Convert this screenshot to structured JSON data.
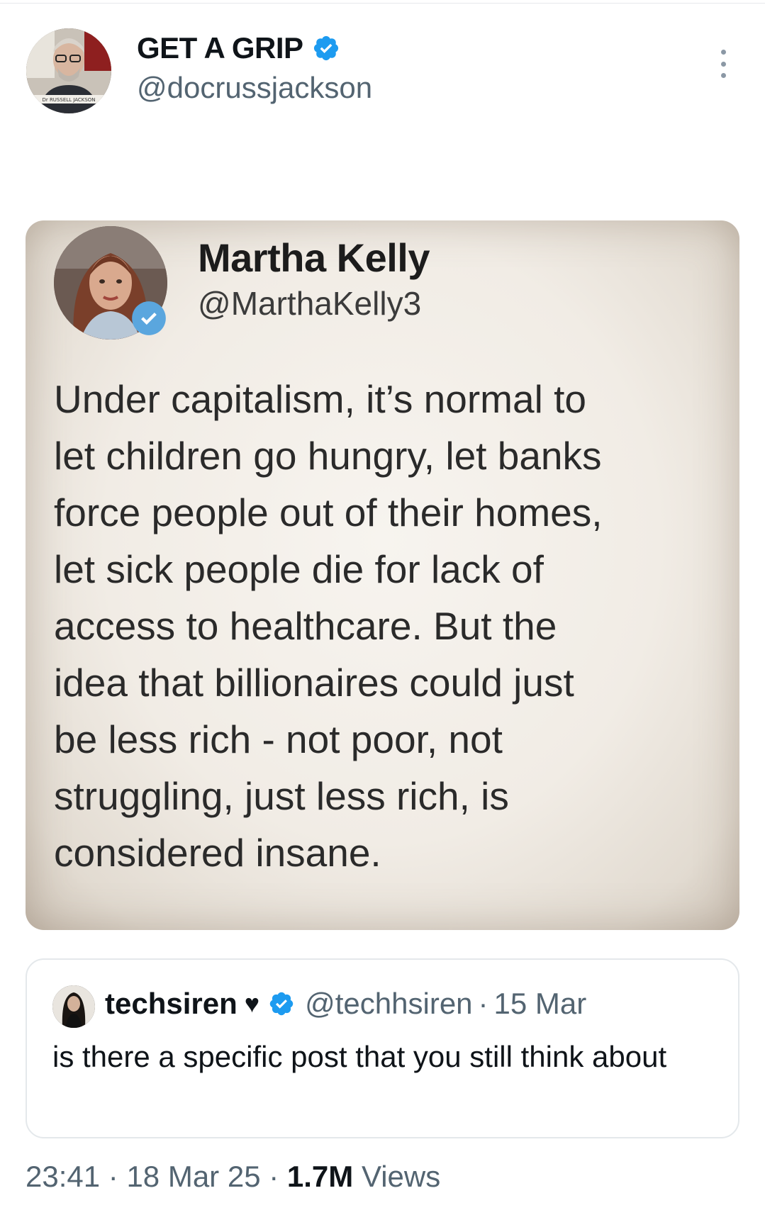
{
  "tweet": {
    "display_name": "GET A GRIP",
    "handle": "@docrussjackson",
    "avatar_caption": "Dr RUSSELL JACKSON",
    "verified_color": "#1d9bf0"
  },
  "media": {
    "name": "Martha Kelly",
    "handle": "@MarthaKelly3",
    "text": "Under capitalism, it’s normal to\nlet children go hungry, let banks\nforce people out of their homes,\nlet sick people die for lack of\naccess to healthcare. But the\nidea that billionaires could just\nbe less rich - not poor, not\nstruggling, just less rich, is\nconsidered insane."
  },
  "quote": {
    "name": "techsiren",
    "heart": "♥",
    "handle": "@techhsiren",
    "separator": "·",
    "date": "15 Mar",
    "text": "is there a specific post that you still think about"
  },
  "meta": {
    "time": "23:41",
    "sep1": "·",
    "date": "18 Mar 25",
    "sep2": "·",
    "views_count": "1.7M",
    "views_label": "Views"
  }
}
